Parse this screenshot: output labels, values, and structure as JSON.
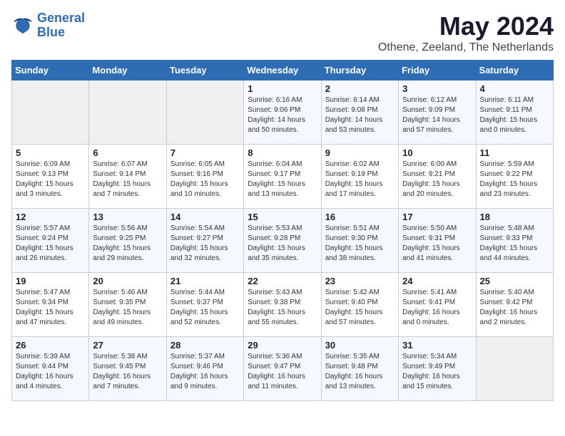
{
  "header": {
    "logo_line1": "General",
    "logo_line2": "Blue",
    "month": "May 2024",
    "location": "Othene, Zeeland, The Netherlands"
  },
  "weekdays": [
    "Sunday",
    "Monday",
    "Tuesday",
    "Wednesday",
    "Thursday",
    "Friday",
    "Saturday"
  ],
  "weeks": [
    [
      {
        "day": "",
        "sunrise": "",
        "sunset": "",
        "daylight": ""
      },
      {
        "day": "",
        "sunrise": "",
        "sunset": "",
        "daylight": ""
      },
      {
        "day": "",
        "sunrise": "",
        "sunset": "",
        "daylight": ""
      },
      {
        "day": "1",
        "sunrise": "Sunrise: 6:16 AM",
        "sunset": "Sunset: 9:06 PM",
        "daylight": "Daylight: 14 hours and 50 minutes."
      },
      {
        "day": "2",
        "sunrise": "Sunrise: 6:14 AM",
        "sunset": "Sunset: 9:08 PM",
        "daylight": "Daylight: 14 hours and 53 minutes."
      },
      {
        "day": "3",
        "sunrise": "Sunrise: 6:12 AM",
        "sunset": "Sunset: 9:09 PM",
        "daylight": "Daylight: 14 hours and 57 minutes."
      },
      {
        "day": "4",
        "sunrise": "Sunrise: 6:11 AM",
        "sunset": "Sunset: 9:11 PM",
        "daylight": "Daylight: 15 hours and 0 minutes."
      }
    ],
    [
      {
        "day": "5",
        "sunrise": "Sunrise: 6:09 AM",
        "sunset": "Sunset: 9:13 PM",
        "daylight": "Daylight: 15 hours and 3 minutes."
      },
      {
        "day": "6",
        "sunrise": "Sunrise: 6:07 AM",
        "sunset": "Sunset: 9:14 PM",
        "daylight": "Daylight: 15 hours and 7 minutes."
      },
      {
        "day": "7",
        "sunrise": "Sunrise: 6:05 AM",
        "sunset": "Sunset: 9:16 PM",
        "daylight": "Daylight: 15 hours and 10 minutes."
      },
      {
        "day": "8",
        "sunrise": "Sunrise: 6:04 AM",
        "sunset": "Sunset: 9:17 PM",
        "daylight": "Daylight: 15 hours and 13 minutes."
      },
      {
        "day": "9",
        "sunrise": "Sunrise: 6:02 AM",
        "sunset": "Sunset: 9:19 PM",
        "daylight": "Daylight: 15 hours and 17 minutes."
      },
      {
        "day": "10",
        "sunrise": "Sunrise: 6:00 AM",
        "sunset": "Sunset: 9:21 PM",
        "daylight": "Daylight: 15 hours and 20 minutes."
      },
      {
        "day": "11",
        "sunrise": "Sunrise: 5:59 AM",
        "sunset": "Sunset: 9:22 PM",
        "daylight": "Daylight: 15 hours and 23 minutes."
      }
    ],
    [
      {
        "day": "12",
        "sunrise": "Sunrise: 5:57 AM",
        "sunset": "Sunset: 9:24 PM",
        "daylight": "Daylight: 15 hours and 26 minutes."
      },
      {
        "day": "13",
        "sunrise": "Sunrise: 5:56 AM",
        "sunset": "Sunset: 9:25 PM",
        "daylight": "Daylight: 15 hours and 29 minutes."
      },
      {
        "day": "14",
        "sunrise": "Sunrise: 5:54 AM",
        "sunset": "Sunset: 9:27 PM",
        "daylight": "Daylight: 15 hours and 32 minutes."
      },
      {
        "day": "15",
        "sunrise": "Sunrise: 5:53 AM",
        "sunset": "Sunset: 9:28 PM",
        "daylight": "Daylight: 15 hours and 35 minutes."
      },
      {
        "day": "16",
        "sunrise": "Sunrise: 5:51 AM",
        "sunset": "Sunset: 9:30 PM",
        "daylight": "Daylight: 15 hours and 38 minutes."
      },
      {
        "day": "17",
        "sunrise": "Sunrise: 5:50 AM",
        "sunset": "Sunset: 9:31 PM",
        "daylight": "Daylight: 15 hours and 41 minutes."
      },
      {
        "day": "18",
        "sunrise": "Sunrise: 5:48 AM",
        "sunset": "Sunset: 9:33 PM",
        "daylight": "Daylight: 15 hours and 44 minutes."
      }
    ],
    [
      {
        "day": "19",
        "sunrise": "Sunrise: 5:47 AM",
        "sunset": "Sunset: 9:34 PM",
        "daylight": "Daylight: 15 hours and 47 minutes."
      },
      {
        "day": "20",
        "sunrise": "Sunrise: 5:46 AM",
        "sunset": "Sunset: 9:35 PM",
        "daylight": "Daylight: 15 hours and 49 minutes."
      },
      {
        "day": "21",
        "sunrise": "Sunrise: 5:44 AM",
        "sunset": "Sunset: 9:37 PM",
        "daylight": "Daylight: 15 hours and 52 minutes."
      },
      {
        "day": "22",
        "sunrise": "Sunrise: 5:43 AM",
        "sunset": "Sunset: 9:38 PM",
        "daylight": "Daylight: 15 hours and 55 minutes."
      },
      {
        "day": "23",
        "sunrise": "Sunrise: 5:42 AM",
        "sunset": "Sunset: 9:40 PM",
        "daylight": "Daylight: 15 hours and 57 minutes."
      },
      {
        "day": "24",
        "sunrise": "Sunrise: 5:41 AM",
        "sunset": "Sunset: 9:41 PM",
        "daylight": "Daylight: 16 hours and 0 minutes."
      },
      {
        "day": "25",
        "sunrise": "Sunrise: 5:40 AM",
        "sunset": "Sunset: 9:42 PM",
        "daylight": "Daylight: 16 hours and 2 minutes."
      }
    ],
    [
      {
        "day": "26",
        "sunrise": "Sunrise: 5:39 AM",
        "sunset": "Sunset: 9:44 PM",
        "daylight": "Daylight: 16 hours and 4 minutes."
      },
      {
        "day": "27",
        "sunrise": "Sunrise: 5:38 AM",
        "sunset": "Sunset: 9:45 PM",
        "daylight": "Daylight: 16 hours and 7 minutes."
      },
      {
        "day": "28",
        "sunrise": "Sunrise: 5:37 AM",
        "sunset": "Sunset: 9:46 PM",
        "daylight": "Daylight: 16 hours and 9 minutes."
      },
      {
        "day": "29",
        "sunrise": "Sunrise: 5:36 AM",
        "sunset": "Sunset: 9:47 PM",
        "daylight": "Daylight: 16 hours and 11 minutes."
      },
      {
        "day": "30",
        "sunrise": "Sunrise: 5:35 AM",
        "sunset": "Sunset: 9:48 PM",
        "daylight": "Daylight: 16 hours and 13 minutes."
      },
      {
        "day": "31",
        "sunrise": "Sunrise: 5:34 AM",
        "sunset": "Sunset: 9:49 PM",
        "daylight": "Daylight: 16 hours and 15 minutes."
      },
      {
        "day": "",
        "sunrise": "",
        "sunset": "",
        "daylight": ""
      }
    ]
  ]
}
